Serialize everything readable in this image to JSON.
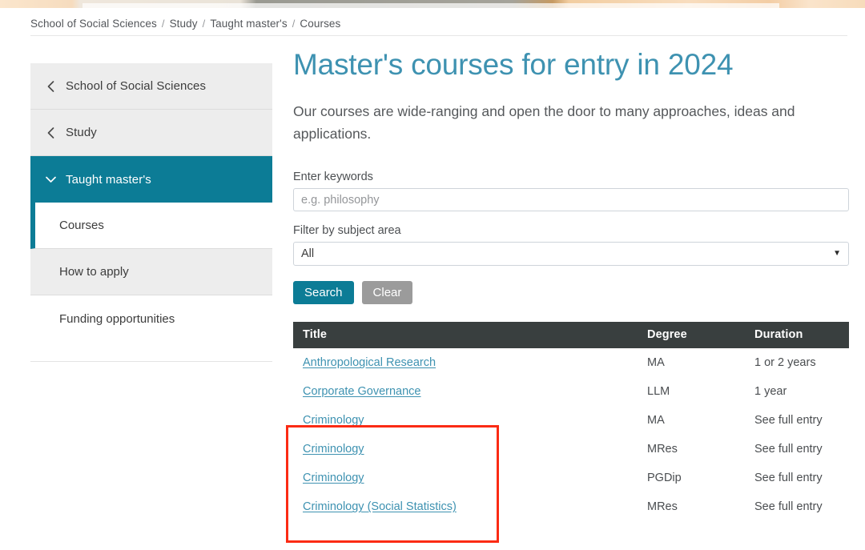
{
  "banner": {
    "alt": "decorative-header-image"
  },
  "breadcrumb": {
    "items": [
      {
        "label": "School of Social Sciences"
      },
      {
        "label": "Study"
      },
      {
        "label": "Taught master's"
      },
      {
        "label": "Courses"
      }
    ],
    "separator": "/"
  },
  "sidebar": {
    "items": [
      {
        "label": "School of Social Sciences",
        "icon": "chevron-left-icon",
        "state": "parent"
      },
      {
        "label": "Study",
        "icon": "chevron-left-icon",
        "state": "parent"
      },
      {
        "label": "Taught master's",
        "icon": "chevron-down-icon",
        "state": "active"
      },
      {
        "label": "Courses",
        "icon": "none",
        "state": "current"
      },
      {
        "label": "How to apply",
        "icon": "none",
        "state": "normal"
      },
      {
        "label": "Funding opportunities",
        "icon": "none",
        "state": "normal"
      }
    ]
  },
  "main": {
    "title": "Master's courses for entry in 2024",
    "intro": "Our courses are wide-ranging and open the door to many approaches, ideas and applications.",
    "search": {
      "keywords_label": "Enter keywords",
      "keywords_value": "",
      "keywords_placeholder": "e.g. philosophy",
      "subject_label": "Filter by subject area",
      "subject_selected": "All",
      "subject_options": [
        "All"
      ],
      "search_button": "Search",
      "clear_button": "Clear"
    },
    "table": {
      "columns": [
        "Title",
        "Degree",
        "Duration"
      ],
      "rows": [
        {
          "title": "Anthropological Research",
          "degree": "MA",
          "duration": "1 or 2 years"
        },
        {
          "title": "Corporate Governance",
          "degree": "LLM",
          "duration": "1 year"
        },
        {
          "title": "Criminology",
          "degree": "MA",
          "duration": "See full entry"
        },
        {
          "title": "Criminology",
          "degree": "MRes",
          "duration": "See full entry"
        },
        {
          "title": "Criminology",
          "degree": "PGDip",
          "duration": "See full entry"
        },
        {
          "title": "Criminology (Social Statistics)",
          "degree": "MRes",
          "duration": "See full entry"
        }
      ]
    }
  },
  "annotation": {
    "highlight_color": "#fb2b14",
    "label": "red-highlight-box"
  },
  "colors": {
    "brand_teal": "#0c7c96",
    "heading_blue": "#3e92b1",
    "table_header": "#393f3f",
    "clear_button": "#9b9b9b",
    "sidebar_bg": "#ededed"
  }
}
